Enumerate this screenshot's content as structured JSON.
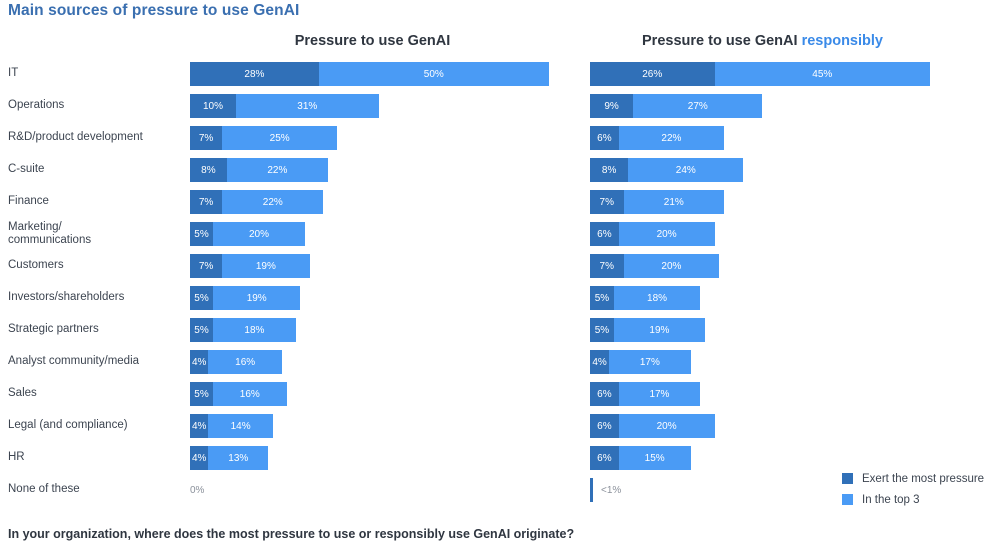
{
  "page_title": "Main sources of pressure to use GenAI",
  "panels": {
    "left": {
      "title": "Pressure to use GenAI",
      "title_accent": ""
    },
    "right": {
      "title": "Pressure to use GenAI ",
      "title_accent": "responsibly"
    }
  },
  "legend": {
    "items": [
      {
        "label": "Exert the most pressure",
        "color": "#3070b8",
        "key": "most"
      },
      {
        "label": "In the top 3",
        "color": "#4a9bf5",
        "key": "top3"
      }
    ]
  },
  "footer_question": "In your organization, where does the most pressure to use or responsibly use GenAI originate?",
  "zero_labels": {
    "left": "0%",
    "right": "<1%"
  },
  "chart_data": {
    "type": "bar",
    "title": "Main sources of pressure to use GenAI",
    "subtitle": "In your organization, where does the most pressure to use or responsibly use GenAI originate?",
    "orientation": "horizontal",
    "stacked": true,
    "unit": "percent",
    "xlabel": "",
    "ylabel": "",
    "xlim": [
      0,
      78
    ],
    "grid": false,
    "legend_position": "bottom-right",
    "panels": [
      "Pressure to use GenAI",
      "Pressure to use GenAI responsibly"
    ],
    "series": [
      {
        "name": "Exert the most pressure",
        "color": "#3070b8"
      },
      {
        "name": "In the top 3",
        "color": "#4a9bf5"
      }
    ],
    "categories": [
      "IT",
      "Operations",
      "R&D/product development",
      "C-suite",
      "Finance",
      "Marketing/\ncommunications",
      "Customers",
      "Investors/shareholders",
      "Strategic partners",
      "Analyst community/media",
      "Sales",
      "Legal (and compliance)",
      "HR",
      "None of these"
    ],
    "rows": [
      {
        "category": "IT",
        "left": {
          "most": 28,
          "most_label": "28%",
          "top3": 50,
          "top3_label": "50%"
        },
        "right": {
          "most": 26,
          "most_label": "26%",
          "top3": 45,
          "top3_label": "45%"
        }
      },
      {
        "category": "Operations",
        "left": {
          "most": 10,
          "most_label": "10%",
          "top3": 31,
          "top3_label": "31%"
        },
        "right": {
          "most": 9,
          "most_label": "9%",
          "top3": 27,
          "top3_label": "27%"
        }
      },
      {
        "category": "R&D/product development",
        "left": {
          "most": 7,
          "most_label": "7%",
          "top3": 25,
          "top3_label": "25%"
        },
        "right": {
          "most": 6,
          "most_label": "6%",
          "top3": 22,
          "top3_label": "22%"
        }
      },
      {
        "category": "C-suite",
        "left": {
          "most": 8,
          "most_label": "8%",
          "top3": 22,
          "top3_label": "22%"
        },
        "right": {
          "most": 8,
          "most_label": "8%",
          "top3": 24,
          "top3_label": "24%"
        }
      },
      {
        "category": "Finance",
        "left": {
          "most": 7,
          "most_label": "7%",
          "top3": 22,
          "top3_label": "22%"
        },
        "right": {
          "most": 7,
          "most_label": "7%",
          "top3": 21,
          "top3_label": "21%"
        }
      },
      {
        "category": "Marketing/\ncommunications",
        "left": {
          "most": 5,
          "most_label": "5%",
          "top3": 20,
          "top3_label": "20%"
        },
        "right": {
          "most": 6,
          "most_label": "6%",
          "top3": 20,
          "top3_label": "20%"
        }
      },
      {
        "category": "Customers",
        "left": {
          "most": 7,
          "most_label": "7%",
          "top3": 19,
          "top3_label": "19%"
        },
        "right": {
          "most": 7,
          "most_label": "7%",
          "top3": 20,
          "top3_label": "20%"
        }
      },
      {
        "category": "Investors/shareholders",
        "left": {
          "most": 5,
          "most_label": "5%",
          "top3": 19,
          "top3_label": "19%"
        },
        "right": {
          "most": 5,
          "most_label": "5%",
          "top3": 18,
          "top3_label": "18%"
        }
      },
      {
        "category": "Strategic partners",
        "left": {
          "most": 5,
          "most_label": "5%",
          "top3": 18,
          "top3_label": "18%"
        },
        "right": {
          "most": 5,
          "most_label": "5%",
          "top3": 19,
          "top3_label": "19%"
        }
      },
      {
        "category": "Analyst community/media",
        "left": {
          "most": 4,
          "most_label": "4%",
          "top3": 16,
          "top3_label": "16%"
        },
        "right": {
          "most": 4,
          "most_label": "4%",
          "top3": 17,
          "top3_label": "17%"
        }
      },
      {
        "category": "Sales",
        "left": {
          "most": 5,
          "most_label": "5%",
          "top3": 16,
          "top3_label": "16%"
        },
        "right": {
          "most": 6,
          "most_label": "6%",
          "top3": 17,
          "top3_label": "17%"
        }
      },
      {
        "category": "Legal (and compliance)",
        "left": {
          "most": 4,
          "most_label": "4%",
          "top3": 14,
          "top3_label": "14%"
        },
        "right": {
          "most": 6,
          "most_label": "6%",
          "top3": 20,
          "top3_label": "20%"
        }
      },
      {
        "category": "HR",
        "left": {
          "most": 4,
          "most_label": "4%",
          "top3": 13,
          "top3_label": "13%"
        },
        "right": {
          "most": 6,
          "most_label": "6%",
          "top3": 15,
          "top3_label": "15%"
        }
      },
      {
        "category": "None of these",
        "left": {
          "most": 0,
          "most_label": "0%",
          "top3": 0,
          "top3_label": ""
        },
        "right": {
          "most": 0.5,
          "most_label": "<1%",
          "top3": 0,
          "top3_label": ""
        }
      }
    ]
  }
}
